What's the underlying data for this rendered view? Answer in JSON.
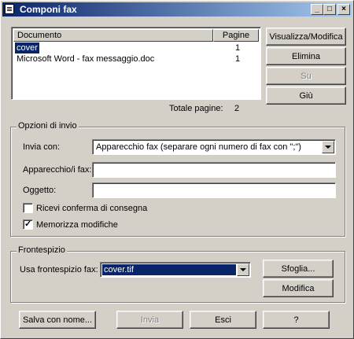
{
  "window": {
    "title": "Componi fax"
  },
  "documents": {
    "col_document": "Documento",
    "col_pages": "Pagine",
    "rows": [
      {
        "name": "cover",
        "pages": "1"
      },
      {
        "name": "Microsoft Word - fax messaggio.doc",
        "pages": "1"
      }
    ],
    "total_label": "Totale pagine:",
    "total_value": "2"
  },
  "side_buttons": {
    "view_edit": "Visualizza/Modifica",
    "delete": "Elimina",
    "up": "Su",
    "down": "Giù"
  },
  "send_options": {
    "legend": "Opzioni di invio",
    "send_with_label": "Invia con:",
    "send_with_value": "Apparecchio fax (separare ogni numero di fax con \";\")",
    "fax_devices_label": "Apparecchio/i fax:",
    "fax_devices_value": "",
    "subject_label": "Oggetto:",
    "subject_value": "",
    "confirm_delivery_label": "Ricevi conferma di consegna",
    "confirm_delivery_checked": false,
    "save_changes_label": "Memorizza modifiche",
    "save_changes_checked": true
  },
  "cover_page": {
    "legend": "Frontespizio",
    "use_cover_label": "Usa frontespizio fax:",
    "cover_value": "cover.tif",
    "browse": "Sfoglia...",
    "edit": "Modifica"
  },
  "bottom_buttons": {
    "save_as": "Salva con nome...",
    "send": "Invia",
    "exit": "Esci",
    "help": "?"
  }
}
